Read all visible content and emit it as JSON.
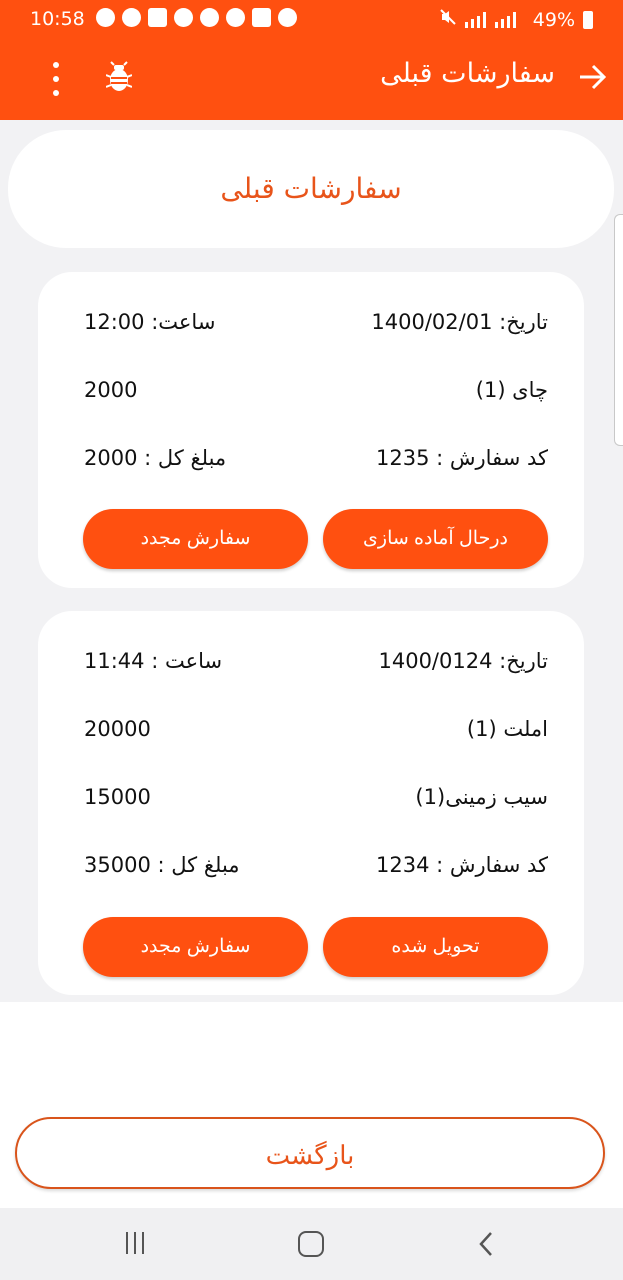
{
  "status_bar": {
    "time": "10:58",
    "battery": "49%"
  },
  "app_bar": {
    "title": "سفارشات قبلی",
    "icons": [
      "more-vert-icon",
      "bug-icon",
      "arrow-back-icon"
    ]
  },
  "header": {
    "title": "سفارشات قبلی"
  },
  "orders": [
    {
      "date_label": "تاریخ: 1400/02/01",
      "time_label": "ساعت: 12:00",
      "items": [
        {
          "name": "چای (1)",
          "price": "2000"
        }
      ],
      "code_label": "کد سفارش : 1235",
      "total_label": "مبلغ کل : 2000",
      "status_button": "درحال آماده سازی",
      "reorder_button": "سفارش مجدد"
    },
    {
      "date_label": "تاریخ: 1400/0124",
      "time_label": "ساعت : 11:44",
      "items": [
        {
          "name": "املت (1)",
          "price": "20000"
        },
        {
          "name": "سیب زمینی(1)",
          "price": "15000"
        }
      ],
      "code_label": "کد سفارش : 1234",
      "total_label": "مبلغ کل : 35000",
      "status_button": "تحویل شده",
      "reorder_button": "سفارش مجدد"
    }
  ],
  "footer": {
    "back_button": "بازگشت"
  },
  "colors": {
    "accent": "#ff5010",
    "accent_text": "#e8541a",
    "background": "#f2f2f4"
  }
}
